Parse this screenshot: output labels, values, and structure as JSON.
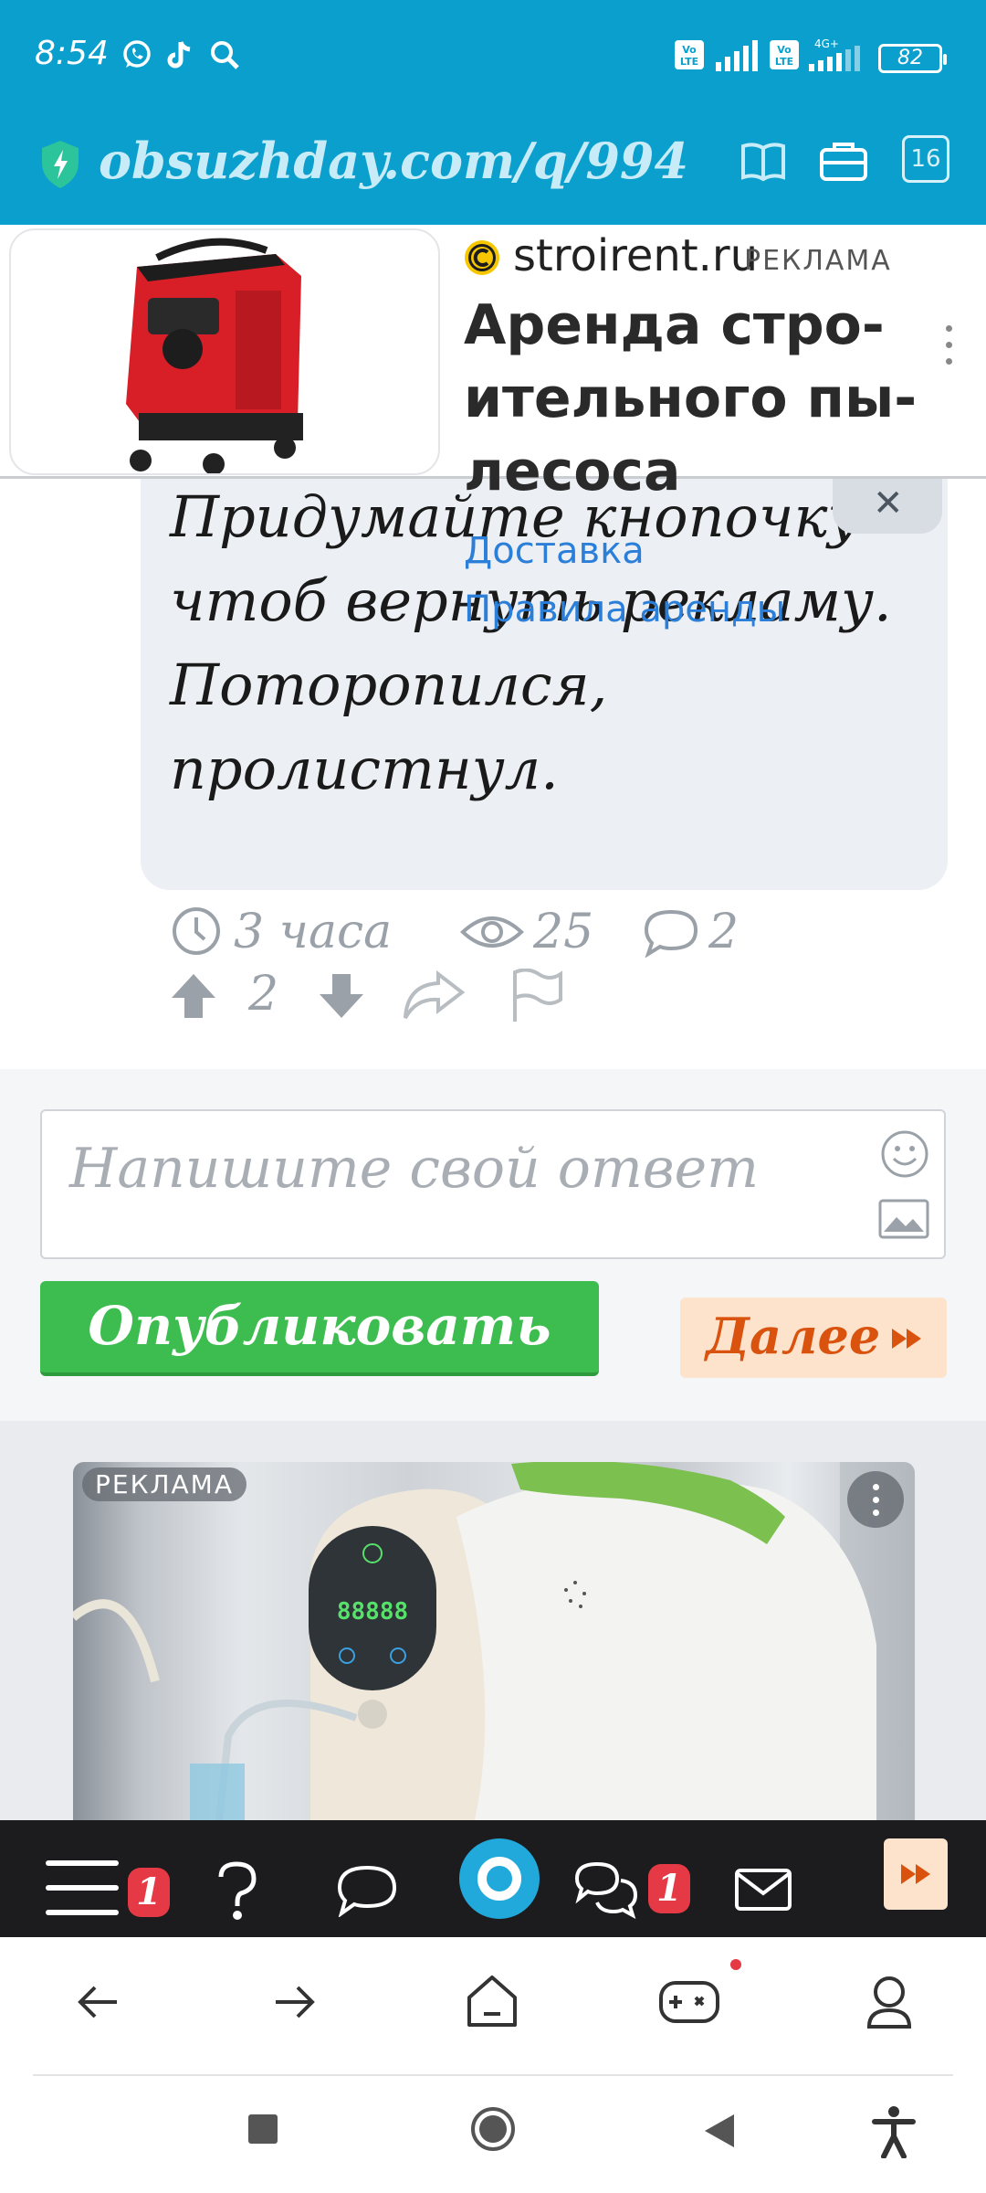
{
  "status_bar": {
    "time": "8:54",
    "battery": "82",
    "network_badge_1": "Vo LTE",
    "network_badge_2": "Vo LTE",
    "network_type": "4G+"
  },
  "url_bar": {
    "url": "obsuzhday.com/q/994",
    "tabs_count": "16"
  },
  "top_ad": {
    "domain": "stroirent.ru",
    "label": "РЕКЛАМА",
    "title": "Аренда стро-ительного пы-лесоса",
    "link_1": "Доставка",
    "link_2": "Правила аренды"
  },
  "comment": {
    "text": "Придумайте кнопочку чтоб вернуть рекламу. Поторопился, пролистнул.",
    "time": "3 часа",
    "views": "25",
    "replies": "2",
    "votes": "2",
    "close_symbol": "✕"
  },
  "answer": {
    "placeholder": "Напишите свой ответ",
    "publish_label": "Опубликовать",
    "next_label": "Далее"
  },
  "bottom_ad": {
    "label": "РЕКЛАМА",
    "display_digits": "88888"
  },
  "site_nav": {
    "menu_badge": "1",
    "chat_badge": "1"
  },
  "colors": {
    "header": "#0b9fcd",
    "publish": "#3dbd4f",
    "next_bg": "#fde3cc",
    "next_text": "#d9530f",
    "badge": "#e53945",
    "link": "#2b7fd8"
  }
}
